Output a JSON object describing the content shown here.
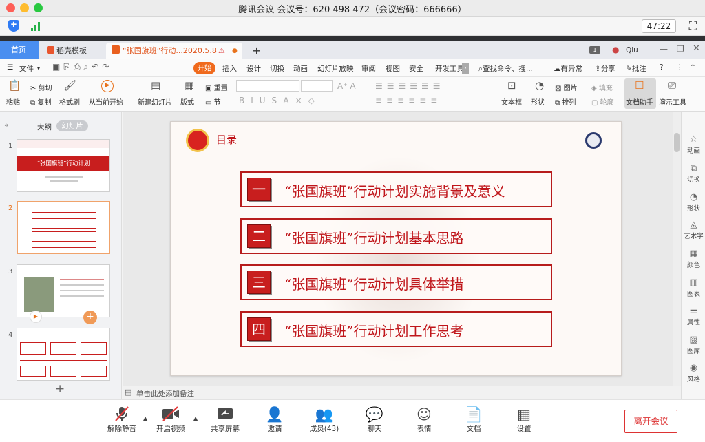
{
  "window": {
    "title": "腾讯会议 会议号：620 498 472（会议密码：666666）"
  },
  "meeting": {
    "timer": "47:22"
  },
  "tabs": {
    "home": "首页",
    "template": "稻壳模板",
    "document": "“张国旗班”行动...2020.5.8",
    "add": "+",
    "user": "Qiu"
  },
  "menu": {
    "file": "文件",
    "items": [
      "开始",
      "插入",
      "设计",
      "切换",
      "动画",
      "幻灯片放映",
      "审阅",
      "视图",
      "安全",
      "开发工具"
    ],
    "search": "查找命令、搜...",
    "issue": "有异常",
    "share": "分享",
    "comment": "批注"
  },
  "ribbon": {
    "paste": "粘贴",
    "cut": "剪切",
    "copy": "复制",
    "format_painter": "格式刷",
    "from_current": "从当前开始",
    "new_slide": "新建幻灯片",
    "layout": "版式",
    "reset": "重置",
    "section": "节",
    "textbox": "文本框",
    "shape": "形状",
    "picture": "图片",
    "fill": "填充",
    "arrange": "排列",
    "outline": "轮廓",
    "doc_assistant": "文档助手",
    "present_tool": "演示工具"
  },
  "leftpanel": {
    "tab_outline": "大纲",
    "tab_slides": "幻灯片",
    "slide_numbers": [
      "1",
      "2",
      "3",
      "4"
    ],
    "slide1_title": "“张国旗班”行动计划",
    "add": "+"
  },
  "slide": {
    "heading": "目录",
    "rows": [
      {
        "num": "一",
        "text": "“张国旗班”行动计划实施背景及意义"
      },
      {
        "num": "二",
        "text": "“张国旗班”行动计划基本思路"
      },
      {
        "num": "三",
        "text": "“张国旗班”行动计划具体举措"
      },
      {
        "num": "四",
        "text": "“张国旗班”行动计划工作思考"
      }
    ]
  },
  "notes": {
    "placeholder": "单击此处添加备注"
  },
  "rightbar": [
    "动画",
    "切换",
    "形状",
    "艺术字",
    "颜色",
    "图表",
    "属性",
    "图库",
    "风格"
  ],
  "bottom": {
    "mute": "解除静音",
    "video": "开启视频",
    "share": "共享屏幕",
    "invite": "邀请",
    "members": "成员(43)",
    "chat": "聊天",
    "emoji": "表情",
    "docs": "文档",
    "settings": "设置",
    "leave": "离开会议"
  },
  "colors": {
    "accent_red": "#c0161b",
    "tab_blue": "#4a8ef0",
    "start_orange": "#f06a1d"
  }
}
